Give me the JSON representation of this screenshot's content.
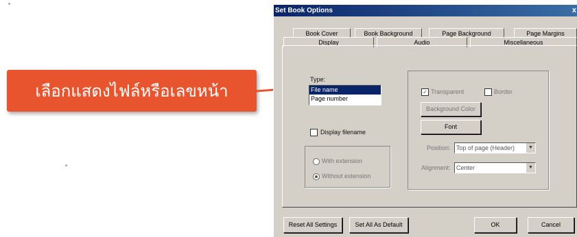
{
  "callout": {
    "text": "เลือกแสดงไฟล์หรือเลขหน้า",
    "color": "#e8542e"
  },
  "dialog": {
    "title": "Set Book Options",
    "close": "x",
    "tabs_back": [
      "Book Cover",
      "Book Background",
      "Page Background",
      "Page Margins"
    ],
    "tabs_front": [
      "Display",
      "Audio",
      "Miscellaneous"
    ],
    "type_label": "Type:",
    "type_options": [
      "File name",
      "Page number"
    ],
    "type_selected": "File name",
    "display_filename_label": "Display filename",
    "with_extension_label": "With extension",
    "without_extension_label": "Without extension",
    "transparent_label": "Transparent",
    "transparent_checked": "✓",
    "border_label": "Border",
    "background_color_button": "Background Color",
    "font_button": "Font",
    "position_label": "Position:",
    "position_value": "Top of page (Header)",
    "alignment_label": "Alignment:",
    "alignment_value": "Center",
    "reset_button": "Reset All Settings",
    "default_button": "Set All As Default",
    "ok_button": "OK",
    "cancel_button": "Cancel"
  },
  "colors": {
    "title_bar": "#0a246a",
    "dialog_face": "#d4d0c8",
    "selection": "#0a246a"
  }
}
